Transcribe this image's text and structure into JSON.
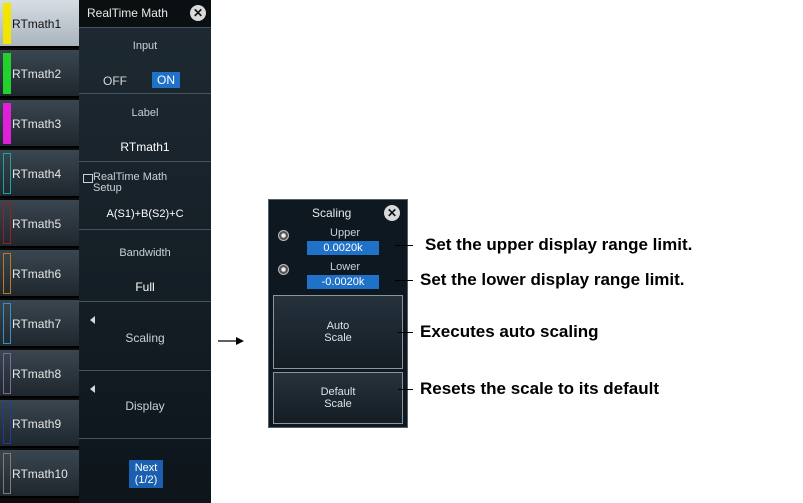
{
  "channels": [
    {
      "label": "RTmath1",
      "color": "#f2e600",
      "active": true
    },
    {
      "label": "RTmath2",
      "color": "#22d12a",
      "active": false
    },
    {
      "label": "RTmath3",
      "color": "#e020d8",
      "active": false
    },
    {
      "label": "RTmath4",
      "color": "#1aa6a0",
      "active": false
    },
    {
      "label": "RTmath5",
      "color": "#9a1e1e",
      "active": false
    },
    {
      "label": "RTmath6",
      "color": "#c07818",
      "active": false
    },
    {
      "label": "RTmath7",
      "color": "#3a8ec0",
      "active": false
    },
    {
      "label": "RTmath8",
      "color": "#7a6a9a",
      "active": false
    },
    {
      "label": "RTmath9",
      "color": "#1e3a9a",
      "active": false
    },
    {
      "label": "RTmath10",
      "color": "#8a7a6a",
      "active": false
    }
  ],
  "menu": {
    "title": "RealTime Math",
    "input": {
      "caption": "Input",
      "off_label": "OFF",
      "on_label": "ON",
      "selected": "ON"
    },
    "label": {
      "caption": "Label",
      "value": "RTmath1"
    },
    "setup": {
      "caption": "RealTime Math Setup",
      "value": "A(S1)+B(S2)+C"
    },
    "bandwidth": {
      "caption": "Bandwidth",
      "value": "Full"
    },
    "scaling_label": "Scaling",
    "display_label": "Display",
    "next_label": "Next",
    "next_page": "(1/2)"
  },
  "scaling_panel": {
    "title": "Scaling",
    "upper_caption": "Upper",
    "upper_value": "0.0020k",
    "lower_caption": "Lower",
    "lower_value": "-0.0020k",
    "auto_scale_label": "Auto\nScale",
    "default_scale_label": "Default\nScale"
  },
  "callouts": {
    "upper": "Set the upper display range limit.",
    "lower": "Set the lower display range limit.",
    "auto": "Executes auto scaling",
    "default": "Resets the scale to its default"
  },
  "colors": {
    "on_highlight": "#1f72c8",
    "field_bg": "#1f72c8"
  }
}
